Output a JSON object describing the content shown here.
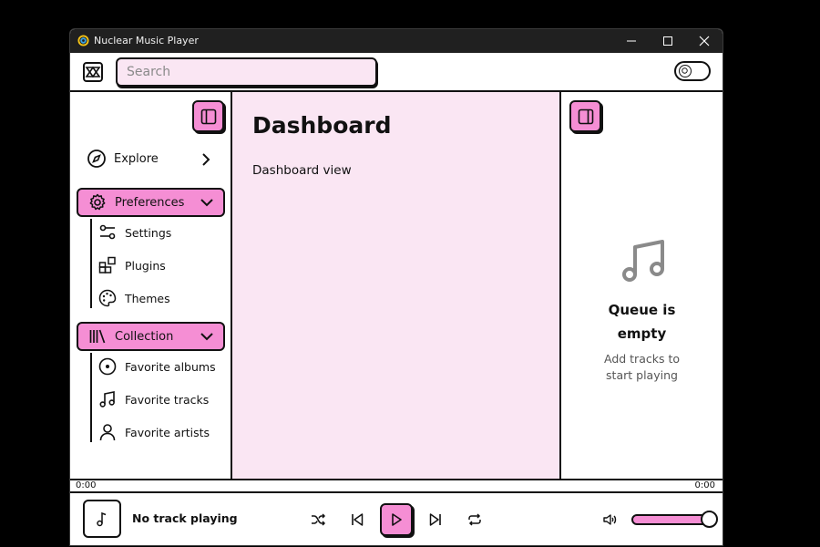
{
  "window": {
    "title": "Nuclear Music Player"
  },
  "topbar": {
    "search_placeholder": "Search"
  },
  "sidebar": {
    "explore": "Explore",
    "preferences": {
      "label": "Preferences",
      "items": [
        {
          "label": "Settings",
          "icon": "sliders-icon"
        },
        {
          "label": "Plugins",
          "icon": "plugins-icon"
        },
        {
          "label": "Themes",
          "icon": "palette-icon"
        }
      ]
    },
    "collection": {
      "label": "Collection",
      "items": [
        {
          "label": "Favorite albums",
          "icon": "disc-icon"
        },
        {
          "label": "Favorite tracks",
          "icon": "music-note-icon"
        },
        {
          "label": "Favorite artists",
          "icon": "user-icon"
        }
      ]
    }
  },
  "main": {
    "title": "Dashboard",
    "subtitle": "Dashboard view"
  },
  "queue": {
    "title": "Queue is empty",
    "subtitle": "Add tracks to start playing"
  },
  "player": {
    "time_elapsed": "0:00",
    "time_total": "0:00",
    "track": "No track playing",
    "volume": 1.0
  },
  "colors": {
    "accent": "#f58ed4",
    "panel": "#fae6f3",
    "border": "#111111",
    "titlebar": "#202020"
  }
}
